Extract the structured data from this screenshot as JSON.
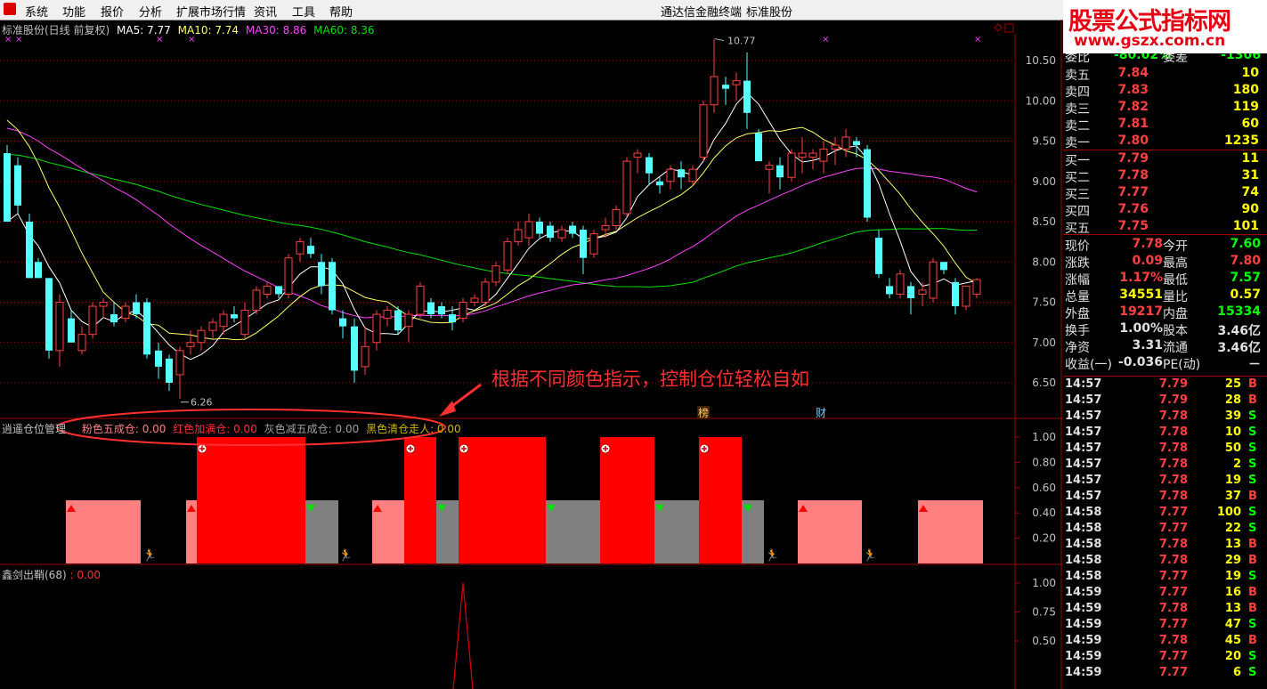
{
  "menu": {
    "items": [
      "系统",
      "功能",
      "报价",
      "分析",
      "扩展市场行情",
      "资讯",
      "工具",
      "帮助"
    ],
    "center_title": "通达信金融终端",
    "center_sub": "标准股份"
  },
  "brand": {
    "title": "股票公式指标网",
    "url": "www.gszx.com.cn"
  },
  "main_chart": {
    "title": "标准股份(日线 前复权)",
    "ma5": "MA5: 7.77",
    "ma10": "MA10: 7.74",
    "ma30": "MA30: 8.86",
    "ma60": "MA60: 8.36",
    "high_label": "10.77",
    "low_label": "6.26",
    "marker1": "榜",
    "marker2": "财",
    "yticks": [
      "10.50",
      "10.00",
      "9.50",
      "9.00",
      "8.50",
      "8.00",
      "7.50",
      "7.00",
      "6.50"
    ]
  },
  "annotation": "根据不同颜色指示，控制仓位轻松自如",
  "indicator1": {
    "name": "逍遥仓位管理",
    "f1": "粉色五成仓: 0.00",
    "f2": "红色加满仓: 0.00",
    "f3": "灰色减五成仓: 0.00",
    "f4": "黑色清仓走人: 0.00",
    "yticks": [
      "1.00",
      "0.80",
      "0.60",
      "0.40",
      "0.20"
    ]
  },
  "indicator2": {
    "name": "鑫剑出鞘(68)",
    "value": ": 0.00",
    "yticks": [
      "1.00",
      "0.75",
      "0.50"
    ]
  },
  "quote": {
    "header": {
      "l": "委比",
      "p": "-80.02%",
      "c": "委差",
      "d": "-1306"
    },
    "sells": [
      {
        "l": "卖五",
        "p": "7.84",
        "v": "10"
      },
      {
        "l": "卖四",
        "p": "7.83",
        "v": "180"
      },
      {
        "l": "卖三",
        "p": "7.82",
        "v": "119"
      },
      {
        "l": "卖二",
        "p": "7.81",
        "v": "60"
      },
      {
        "l": "卖一",
        "p": "7.80",
        "v": "1235"
      }
    ],
    "buys": [
      {
        "l": "买一",
        "p": "7.79",
        "v": "11"
      },
      {
        "l": "买二",
        "p": "7.78",
        "v": "31"
      },
      {
        "l": "买三",
        "p": "7.77",
        "v": "74"
      },
      {
        "l": "买四",
        "p": "7.76",
        "v": "90"
      },
      {
        "l": "买五",
        "p": "7.75",
        "v": "101"
      }
    ],
    "stats": [
      {
        "a": "现价",
        "b": "7.78",
        "bc": "#ff4040",
        "c": "今开",
        "d": "7.60",
        "dc": "#00ff00"
      },
      {
        "a": "涨跌",
        "b": "0.09",
        "bc": "#ff4040",
        "c": "最高",
        "d": "7.80",
        "dc": "#ff4040"
      },
      {
        "a": "涨幅",
        "b": "1.17%",
        "bc": "#ff4040",
        "c": "最低",
        "d": "7.57",
        "dc": "#00ff00"
      },
      {
        "a": "总量",
        "b": "34551",
        "bc": "#ffff00",
        "c": "量比",
        "d": "0.57",
        "dc": "#ffff00"
      },
      {
        "a": "外盘",
        "b": "19217",
        "bc": "#ff4040",
        "c": "内盘",
        "d": "15334",
        "dc": "#00ff00"
      },
      {
        "a": "换手",
        "b": "1.00%",
        "bc": "#e0e0e0",
        "c": "股本",
        "d": "3.46亿",
        "dc": "#e0e0e0"
      },
      {
        "a": "净资",
        "b": "3.31",
        "bc": "#e0e0e0",
        "c": "流通",
        "d": "3.46亿",
        "dc": "#e0e0e0"
      },
      {
        "a": "收益(一)",
        "b": "-0.036",
        "bc": "#e0e0e0",
        "c": "PE(动)",
        "d": "－",
        "dc": "#e0e0e0"
      }
    ],
    "ticks": [
      {
        "t": "14:57",
        "p": "7.79",
        "pc": "#ff4040",
        "v": "25",
        "d": "B",
        "dc": "#ff4040"
      },
      {
        "t": "14:57",
        "p": "7.79",
        "pc": "#ff4040",
        "v": "28",
        "d": "B",
        "dc": "#ff4040"
      },
      {
        "t": "14:57",
        "p": "7.78",
        "pc": "#ff4040",
        "v": "39",
        "d": "S",
        "dc": "#00ff00"
      },
      {
        "t": "14:57",
        "p": "7.78",
        "pc": "#ff4040",
        "v": "10",
        "d": "S",
        "dc": "#00ff00"
      },
      {
        "t": "14:57",
        "p": "7.78",
        "pc": "#ff4040",
        "v": "50",
        "d": "S",
        "dc": "#00ff00"
      },
      {
        "t": "14:57",
        "p": "7.78",
        "pc": "#ff4040",
        "v": "2",
        "d": "S",
        "dc": "#00ff00"
      },
      {
        "t": "14:57",
        "p": "7.78",
        "pc": "#ff4040",
        "v": "19",
        "d": "S",
        "dc": "#00ff00"
      },
      {
        "t": "14:57",
        "p": "7.78",
        "pc": "#ff4040",
        "v": "37",
        "d": "B",
        "dc": "#ff4040"
      },
      {
        "t": "14:58",
        "p": "7.77",
        "pc": "#ff4040",
        "v": "100",
        "d": "S",
        "dc": "#00ff00"
      },
      {
        "t": "14:58",
        "p": "7.77",
        "pc": "#ff4040",
        "v": "22",
        "d": "S",
        "dc": "#00ff00"
      },
      {
        "t": "14:58",
        "p": "7.78",
        "pc": "#ff4040",
        "v": "13",
        "d": "B",
        "dc": "#ff4040"
      },
      {
        "t": "14:58",
        "p": "7.78",
        "pc": "#ff4040",
        "v": "29",
        "d": "B",
        "dc": "#ff4040"
      },
      {
        "t": "14:58",
        "p": "7.77",
        "pc": "#ff4040",
        "v": "19",
        "d": "S",
        "dc": "#00ff00"
      },
      {
        "t": "14:59",
        "p": "7.77",
        "pc": "#ff4040",
        "v": "16",
        "d": "B",
        "dc": "#ff4040"
      },
      {
        "t": "14:59",
        "p": "7.78",
        "pc": "#ff4040",
        "v": "13",
        "d": "B",
        "dc": "#ff4040"
      },
      {
        "t": "14:59",
        "p": "7.77",
        "pc": "#ff4040",
        "v": "47",
        "d": "S",
        "dc": "#00ff00"
      },
      {
        "t": "14:59",
        "p": "7.78",
        "pc": "#ff4040",
        "v": "45",
        "d": "B",
        "dc": "#ff4040"
      },
      {
        "t": "14:59",
        "p": "7.77",
        "pc": "#ff4040",
        "v": "20",
        "d": "S",
        "dc": "#00ff00"
      },
      {
        "t": "14:59",
        "p": "7.77",
        "pc": "#ff4040",
        "v": "6",
        "d": "S",
        "dc": "#00ff00"
      }
    ]
  },
  "colors": {
    "up": "#ff4040",
    "down": "#54ffff",
    "ma5": "#ffffff",
    "ma10": "#ffff64",
    "ma30": "#ff40ff",
    "ma60": "#00e000",
    "grid": "#a00000"
  }
}
